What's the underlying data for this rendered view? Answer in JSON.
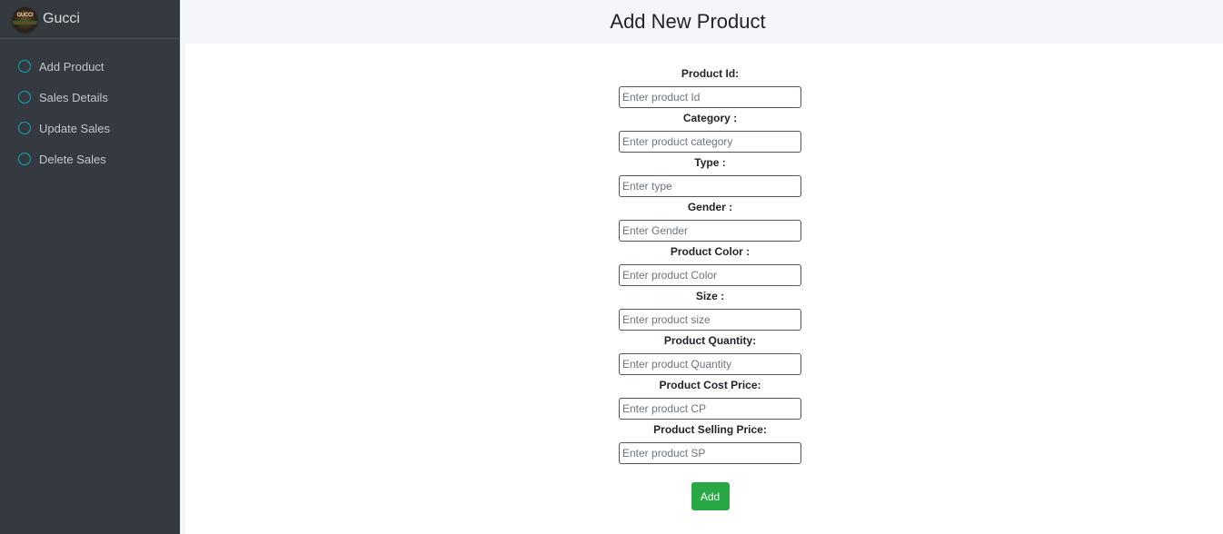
{
  "brand": {
    "name": "Gucci",
    "logo_text": "GUCCI"
  },
  "sidebar": {
    "items": [
      {
        "label": "Add Product",
        "icon": "circle-icon"
      },
      {
        "label": "Sales Details",
        "icon": "circle-icon"
      },
      {
        "label": "Update Sales",
        "icon": "circle-icon"
      },
      {
        "label": "Delete Sales",
        "icon": "circle-icon"
      }
    ]
  },
  "header": {
    "title": "Add New Product"
  },
  "form": {
    "fields": [
      {
        "label": "Product Id:",
        "placeholder": "Enter product Id",
        "value": ""
      },
      {
        "label": "Category :",
        "placeholder": "Enter product category",
        "value": ""
      },
      {
        "label": "Type :",
        "placeholder": "Enter type",
        "value": ""
      },
      {
        "label": "Gender :",
        "placeholder": "Enter Gender",
        "value": ""
      },
      {
        "label": "Product Color :",
        "placeholder": "Enter product Color",
        "value": ""
      },
      {
        "label": "Size :",
        "placeholder": "Enter product size",
        "value": ""
      },
      {
        "label": "Product Quantity:",
        "placeholder": "Enter product Quantity",
        "value": ""
      },
      {
        "label": "Product Cost Price:",
        "placeholder": "Enter product CP",
        "value": ""
      },
      {
        "label": "Product Selling Price:",
        "placeholder": "Enter product SP",
        "value": ""
      }
    ],
    "submit_label": "Add"
  },
  "colors": {
    "sidebar_bg": "#343a40",
    "nav_icon": "#17a2b8",
    "submit_bg": "#28a745",
    "page_bg": "#f4f6f9"
  }
}
